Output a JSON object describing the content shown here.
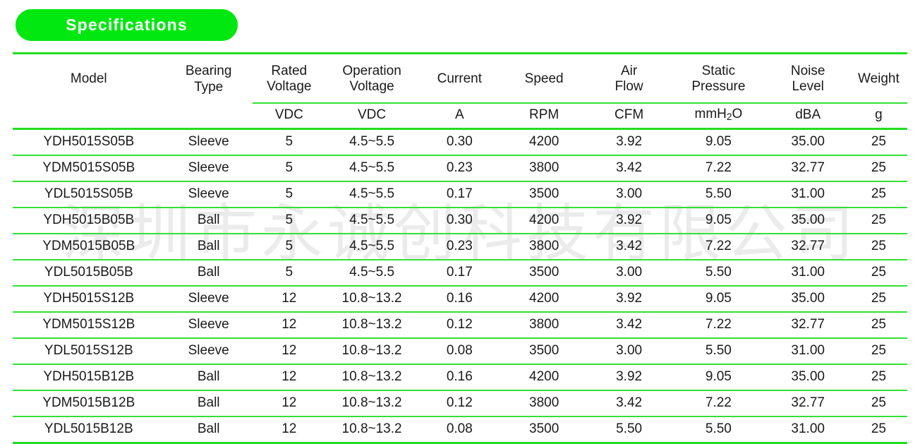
{
  "header": {
    "title": "Specifications"
  },
  "watermark": {
    "text": "深圳市永诚创科技有限公司"
  },
  "colors": {
    "accent_green": "#00e810",
    "rule_green": "#22dd22",
    "thin_rule_green": "#33e033",
    "title_text": "#ffffff",
    "body_text": "#1a1a1a",
    "watermark": "#ebebeb"
  },
  "table": {
    "columns": [
      {
        "label": "Model",
        "unit": ""
      },
      {
        "label": "Bearing\nType",
        "unit": ""
      },
      {
        "label": "Rated\nVoltage",
        "unit": "VDC"
      },
      {
        "label": "Operation\nVoltage",
        "unit": "VDC"
      },
      {
        "label": "Current",
        "unit": "A"
      },
      {
        "label": "Speed",
        "unit": "RPM"
      },
      {
        "label": "Air\nFlow",
        "unit": "CFM"
      },
      {
        "label": "Static\nPressure",
        "unit": "mmH2O"
      },
      {
        "label": "Noise\nLevel",
        "unit": "dBA"
      },
      {
        "label": "Weight",
        "unit": "g"
      }
    ],
    "column_labels_line1": [
      "Model",
      "Bearing",
      "Rated",
      "Operation",
      "Current",
      "Speed",
      "Air",
      "Static",
      "Noise",
      "Weight"
    ],
    "column_labels_line2": [
      "",
      "Type",
      "Voltage",
      "Voltage",
      "",
      "",
      "Flow",
      "Pressure",
      "Level",
      ""
    ],
    "units": [
      "",
      "",
      "VDC",
      "VDC",
      "A",
      "RPM",
      "CFM",
      "mmH2O",
      "dBA",
      "g"
    ],
    "rows": [
      {
        "model": "YDH5015S05B",
        "bearing": "Sleeve",
        "rated_voltage": "5",
        "operation_voltage": "4.5~5.5",
        "current": "0.30",
        "speed": "4200",
        "air_flow": "3.92",
        "static_pressure": "9.05",
        "noise_level": "35.00",
        "weight": "25"
      },
      {
        "model": "YDM5015S05B",
        "bearing": "Sleeve",
        "rated_voltage": "5",
        "operation_voltage": "4.5~5.5",
        "current": "0.23",
        "speed": "3800",
        "air_flow": "3.42",
        "static_pressure": "7.22",
        "noise_level": "32.77",
        "weight": "25"
      },
      {
        "model": "YDL5015S05B",
        "bearing": "Sleeve",
        "rated_voltage": "5",
        "operation_voltage": "4.5~5.5",
        "current": "0.17",
        "speed": "3500",
        "air_flow": "3.00",
        "static_pressure": "5.50",
        "noise_level": "31.00",
        "weight": "25"
      },
      {
        "model": "YDH5015B05B",
        "bearing": "Ball",
        "rated_voltage": "5",
        "operation_voltage": "4.5~5.5",
        "current": "0.30",
        "speed": "4200",
        "air_flow": "3.92",
        "static_pressure": "9.05",
        "noise_level": "35.00",
        "weight": "25"
      },
      {
        "model": "YDM5015B05B",
        "bearing": "Ball",
        "rated_voltage": "5",
        "operation_voltage": "4.5~5.5",
        "current": "0.23",
        "speed": "3800",
        "air_flow": "3.42",
        "static_pressure": "7.22",
        "noise_level": "32.77",
        "weight": "25"
      },
      {
        "model": "YDL5015B05B",
        "bearing": "Ball",
        "rated_voltage": "5",
        "operation_voltage": "4.5~5.5",
        "current": "0.17",
        "speed": "3500",
        "air_flow": "3.00",
        "static_pressure": "5.50",
        "noise_level": "31.00",
        "weight": "25"
      },
      {
        "model": "YDH5015S12B",
        "bearing": "Sleeve",
        "rated_voltage": "12",
        "operation_voltage": "10.8~13.2",
        "current": "0.16",
        "speed": "4200",
        "air_flow": "3.92",
        "static_pressure": "9.05",
        "noise_level": "35.00",
        "weight": "25"
      },
      {
        "model": "YDM5015S12B",
        "bearing": "Sleeve",
        "rated_voltage": "12",
        "operation_voltage": "10.8~13.2",
        "current": "0.12",
        "speed": "3800",
        "air_flow": "3.42",
        "static_pressure": "7.22",
        "noise_level": "32.77",
        "weight": "25"
      },
      {
        "model": "YDL5015S12B",
        "bearing": "Sleeve",
        "rated_voltage": "12",
        "operation_voltage": "10.8~13.2",
        "current": "0.08",
        "speed": "3500",
        "air_flow": "3.00",
        "static_pressure": "5.50",
        "noise_level": "31.00",
        "weight": "25"
      },
      {
        "model": "YDH5015B12B",
        "bearing": "Ball",
        "rated_voltage": "12",
        "operation_voltage": "10.8~13.2",
        "current": "0.16",
        "speed": "4200",
        "air_flow": "3.92",
        "static_pressure": "9.05",
        "noise_level": "35.00",
        "weight": "25"
      },
      {
        "model": "YDM5015B12B",
        "bearing": "Ball",
        "rated_voltage": "12",
        "operation_voltage": "10.8~13.2",
        "current": "0.12",
        "speed": "3800",
        "air_flow": "3.42",
        "static_pressure": "7.22",
        "noise_level": "32.77",
        "weight": "25"
      },
      {
        "model": "YDL5015B12B",
        "bearing": "Ball",
        "rated_voltage": "12",
        "operation_voltage": "10.8~13.2",
        "current": "0.08",
        "speed": "3500",
        "air_flow": "5.50",
        "static_pressure": "5.50",
        "noise_level": "31.00",
        "weight": "25"
      }
    ]
  }
}
